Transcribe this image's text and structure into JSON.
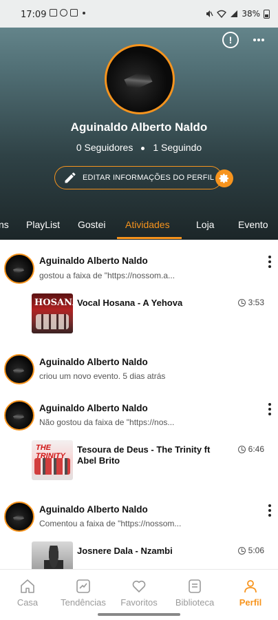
{
  "status_bar": {
    "time": "17:09",
    "battery": "38%",
    "left_icons": [
      "photo-icon",
      "sync-icon",
      "youtube-icon"
    ],
    "right_icons": [
      "mute-icon",
      "wifi-icon",
      "signal-icon",
      "battery-icon"
    ]
  },
  "profile": {
    "name": "Aguinaldo Alberto Naldo",
    "followers": "0 Seguidores",
    "following": "1 Seguindo",
    "edit_label": "EDITAR INFORMAÇÕES DO PERFIL",
    "accent_color": "#f7941d"
  },
  "tabs": [
    {
      "label": "ns"
    },
    {
      "label": "PlayList"
    },
    {
      "label": "Gostei"
    },
    {
      "label": "Atividades",
      "active": true
    },
    {
      "label": "Loja"
    },
    {
      "label": "Evento"
    }
  ],
  "activities": [
    {
      "user": "Aguinaldo Alberto Naldo",
      "text": "gostou a faixa de \"https://nossom.a...",
      "has_menu": true,
      "track": {
        "title": "Vocal Hosana - A Yehova",
        "duration": "3:53",
        "cover_text": "HOSANA"
      }
    },
    {
      "user": "Aguinaldo Alberto Naldo",
      "text": "criou um novo evento. 5 dias atrás",
      "has_menu": false
    },
    {
      "user": "Aguinaldo Alberto Naldo",
      "text": "Não gostou da faixa de \"https://nos...",
      "has_menu": true,
      "track": {
        "title": "Tesoura de Deus - The Trinity ft Abel Brito",
        "duration": "6:46",
        "cover_text": "THE TRINITY"
      }
    },
    {
      "user": "Aguinaldo Alberto Naldo",
      "text": "Comentou a faixa de \"https://nossom...",
      "has_menu": true,
      "track": {
        "title": "Josnere Dala - Nzambi",
        "duration": "5:06"
      }
    }
  ],
  "bottom_nav": [
    {
      "label": "Casa",
      "icon": "home-icon"
    },
    {
      "label": "Tendências",
      "icon": "trending-icon"
    },
    {
      "label": "Favoritos",
      "icon": "heart-icon"
    },
    {
      "label": "Biblioteca",
      "icon": "library-icon"
    },
    {
      "label": "Perfil",
      "icon": "profile-icon",
      "active": true
    }
  ]
}
